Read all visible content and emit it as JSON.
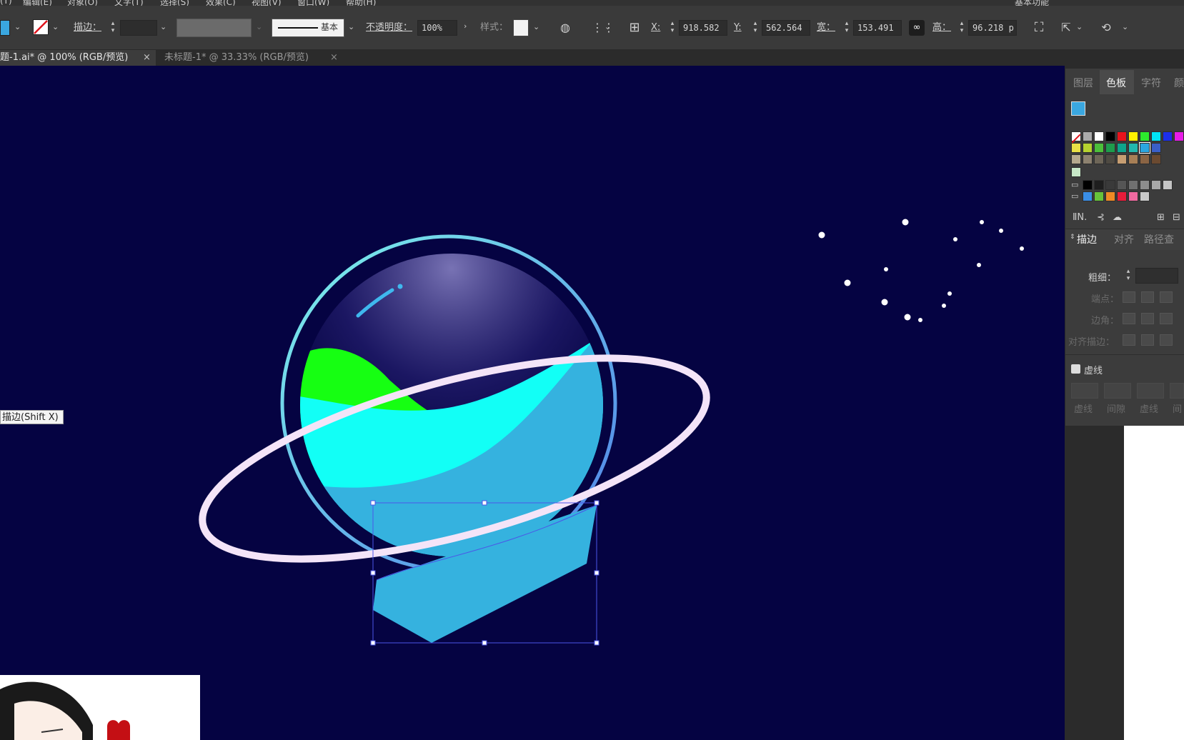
{
  "menubar": {
    "items": [
      "(T)",
      "编辑(E)",
      "对象(O)",
      "文字(T)",
      "选择(S)",
      "效果(C)",
      "视图(V)",
      "窗口(W)",
      "帮助(H)"
    ],
    "right_text": "基本功能"
  },
  "controlbar": {
    "stroke_label": "描边：",
    "stroke_style_label": "基本",
    "opacity_label": "不透明度：",
    "opacity_value": "100%",
    "style_label": "样式：",
    "x_label": "X:",
    "x_value": "918.582",
    "y_label": "Y:",
    "y_value": "562.564",
    "w_label": "宽：",
    "w_value": "153.491",
    "h_label": "高：",
    "h_value": "96.218 p",
    "fill_color": "#3aa7e0"
  },
  "tabs": [
    {
      "label": "题-1.ai* @ 100% (RGB/预览)",
      "active": true
    },
    {
      "label": "未标题-1* @ 33.33% (RGB/预览)",
      "active": false
    }
  ],
  "tooltip": "描边(Shift X)",
  "colors": {
    "canvas_bg": "#050342",
    "ring": "#f4e4f8",
    "planet_cyan": "#12fff6",
    "planet_green": "#16ff12",
    "planet_blue": "#35b2df",
    "orbit_start": "#7df3ea",
    "orbit_end": "#4f7ee8"
  },
  "panel": {
    "tabs": [
      {
        "label": "图层",
        "active": false
      },
      {
        "label": "色板",
        "active": true
      },
      {
        "label": "字符",
        "active": false
      },
      {
        "label": "颜",
        "active": false
      }
    ],
    "section_tabs": [
      {
        "label": "描边",
        "active": true
      },
      {
        "label": "对齐",
        "active": false
      },
      {
        "label": "路径查",
        "active": false
      }
    ],
    "weight_label": "粗细：",
    "cap_label": "端点：",
    "corner_label": "边角：",
    "align_label": "对齐描边：",
    "dashed_label": "虚线",
    "dash_labels": [
      "虚线",
      "间隙",
      "虚线",
      "间"
    ],
    "swatches_row1": [
      "#ffffff",
      "#000000",
      "#e8141c",
      "#fff200",
      "#2dea2d",
      "#00e5f5",
      "#1c2fea",
      "#e81ce8"
    ],
    "swatches_row2": [
      "#e9e046",
      "#b6d22f",
      "#4cbf3a",
      "#1e9c4c",
      "#0da58c",
      "#22b8ae",
      "#2ba6e0",
      "#3a5fc8"
    ],
    "swatches_row3": [
      "#b5a98e",
      "#8d8270",
      "#6e6658",
      "#4e4a42",
      "#c79e72",
      "#a77f56",
      "#8a6444",
      "#6b4a30"
    ],
    "swatches_gray": [
      "#000000",
      "#1e1e1e",
      "#3a3a3a",
      "#555555",
      "#707070",
      "#8c8c8c",
      "#a8a8a8",
      "#c4c4c4"
    ],
    "swatches_group": [
      "#3a8ee6",
      "#67c23a",
      "#f08a24",
      "#e81c3a",
      "#f06aa0",
      "#c8c8c8"
    ]
  }
}
